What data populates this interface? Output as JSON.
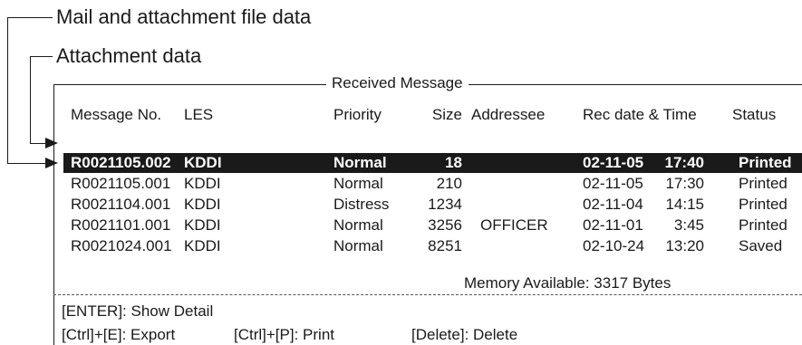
{
  "annotations": {
    "mail_attachment": "Mail and attachment file data",
    "attachment": "Attachment data"
  },
  "panel": {
    "title": "Received Message",
    "columns": {
      "message_no": "Message No.",
      "les": "LES",
      "priority": "Priority",
      "size": "Size",
      "addressee": "Addressee",
      "rec_date_time": "Rec date & Time",
      "status": "Status"
    },
    "rows": [
      {
        "message_no": "R0021105.002",
        "les": "KDDI",
        "priority": "Normal",
        "size": "18",
        "addressee": "",
        "rec_date": "02-11-05",
        "rec_time": "17:40",
        "status": "Printed",
        "selected": true
      },
      {
        "message_no": "R0021105.001",
        "les": "KDDI",
        "priority": "Normal",
        "size": "210",
        "addressee": "",
        "rec_date": "02-11-05",
        "rec_time": "17:30",
        "status": "Printed",
        "selected": false
      },
      {
        "message_no": "R0021104.001",
        "les": "KDDI",
        "priority": "Distress",
        "size": "1234",
        "addressee": "",
        "rec_date": "02-11-04",
        "rec_time": "14:15",
        "status": "Printed",
        "selected": false
      },
      {
        "message_no": "R0021101.001",
        "les": "KDDI",
        "priority": "Normal",
        "size": "3256",
        "addressee": "OFFICER",
        "rec_date": "02-11-01",
        "rec_time": "3:45",
        "status": "Printed",
        "selected": false
      },
      {
        "message_no": "R0021024.001",
        "les": "KDDI",
        "priority": "Normal",
        "size": "8251",
        "addressee": "",
        "rec_date": "02-10-24",
        "rec_time": "13:20",
        "status": "Saved",
        "selected": false
      }
    ],
    "memory": "Memory Available: 3317 Bytes",
    "keys": {
      "enter": "[ENTER]: Show Detail",
      "export": "[Ctrl]+[E]: Export",
      "print": "[Ctrl]+[P]: Print",
      "delete": "[Delete]: Delete"
    }
  }
}
